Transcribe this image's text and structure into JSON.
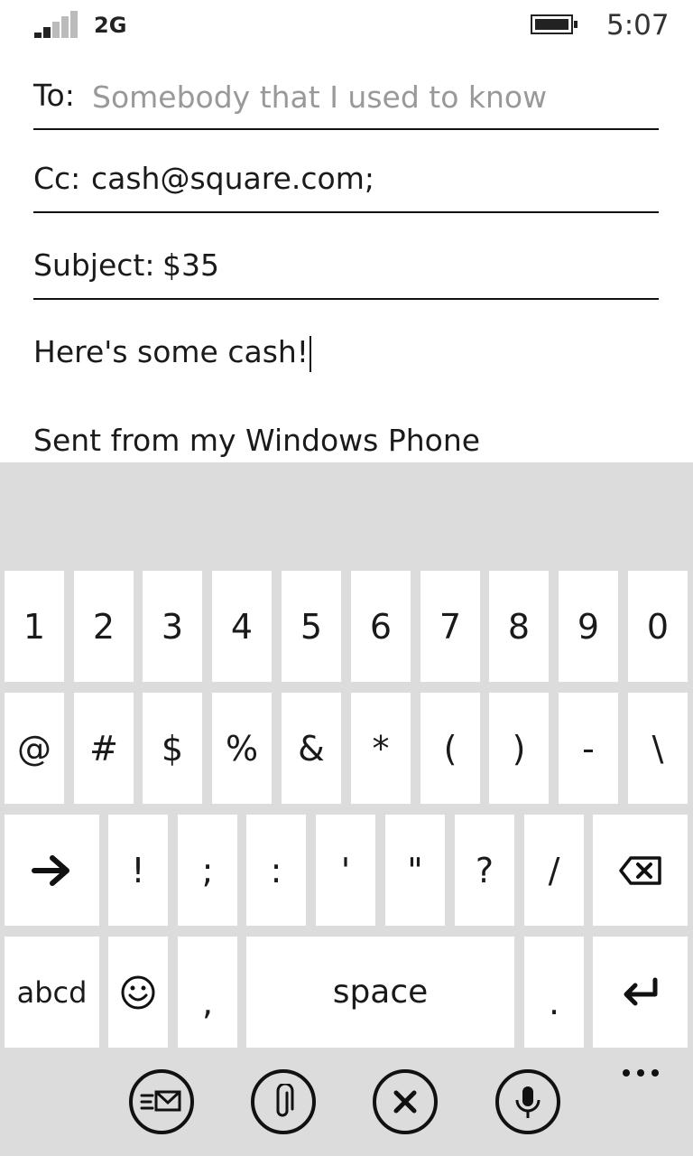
{
  "status_bar": {
    "network": "2G",
    "time": "5:07",
    "signal_icon": "signal-bars-icon",
    "battery_icon": "battery-icon"
  },
  "compose": {
    "to_label": "To:",
    "to_placeholder": "Somebody that I used to know",
    "cc_label": "Cc:",
    "cc_value": "cash@square.com;",
    "subject_label": "Subject:",
    "subject_value": "$35",
    "body_text": "Here's some cash!",
    "signature": "Sent from my Windows Phone"
  },
  "keyboard": {
    "row1": [
      "1",
      "2",
      "3",
      "4",
      "5",
      "6",
      "7",
      "8",
      "9",
      "0"
    ],
    "row2": [
      "@",
      "#",
      "$",
      "%",
      "&",
      "*",
      "(",
      ")",
      "-",
      "\\"
    ],
    "row3": [
      "!",
      ";",
      ":",
      "'",
      "\"",
      "?",
      "/"
    ],
    "abc_label": "abcd",
    "comma_label": ",",
    "space_label": "space",
    "period_label": "."
  },
  "app_bar": {
    "buttons": [
      "send-icon",
      "attach-icon",
      "discard-icon",
      "dictate-icon"
    ],
    "more_icon": "more-dots-icon"
  }
}
